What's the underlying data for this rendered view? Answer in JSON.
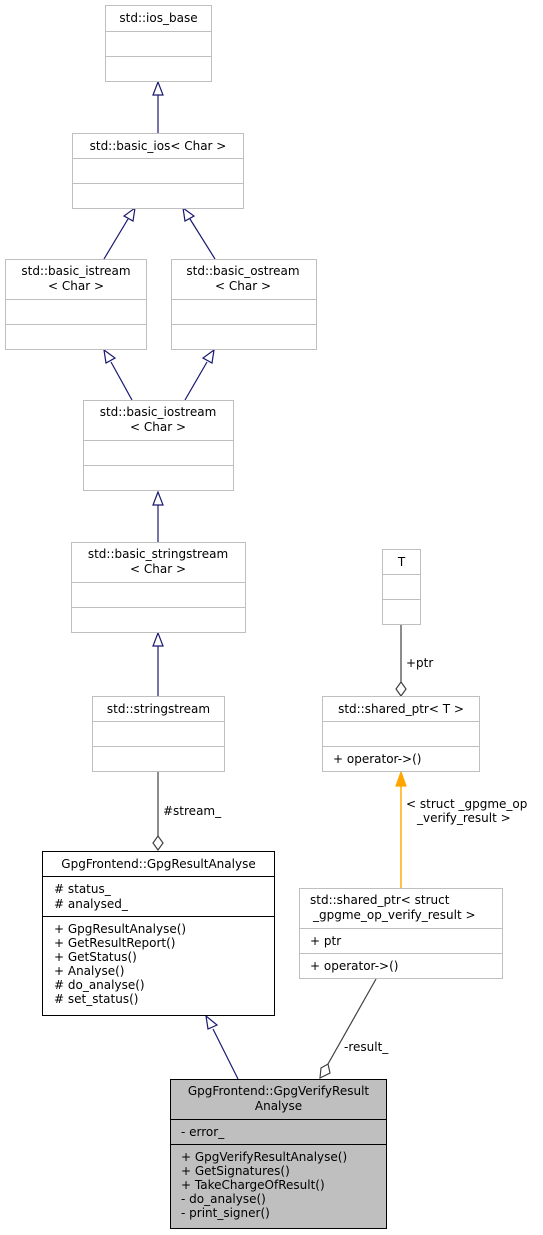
{
  "diagram": {
    "type": "uml-class-collaboration",
    "classes": {
      "ios_base": {
        "title": [
          "std::ios_base"
        ],
        "attributes": [],
        "methods": []
      },
      "basic_ios": {
        "title": [
          "std::basic_ios< Char >"
        ],
        "attributes": [],
        "methods": []
      },
      "basic_istream": {
        "title": [
          "std::basic_istream",
          "< Char >"
        ],
        "attributes": [],
        "methods": []
      },
      "basic_ostream": {
        "title": [
          "std::basic_ostream",
          "< Char >"
        ],
        "attributes": [],
        "methods": []
      },
      "basic_iostream": {
        "title": [
          "std::basic_iostream",
          "< Char >"
        ],
        "attributes": [],
        "methods": []
      },
      "basic_stringstream": {
        "title": [
          "std::basic_stringstream",
          "< Char >"
        ],
        "attributes": [],
        "methods": []
      },
      "stringstream": {
        "title": [
          "std::stringstream"
        ],
        "attributes": [],
        "methods": []
      },
      "T": {
        "title": [
          "T"
        ],
        "attributes": [],
        "methods": []
      },
      "shared_ptr_T": {
        "title": [
          "std::shared_ptr< T >"
        ],
        "attributes": [],
        "methods": [
          "+ operator->()"
        ]
      },
      "shared_ptr_verify": {
        "title": [
          "std::shared_ptr< struct",
          "_gpgme_op_verify_result >"
        ],
        "attributes": [
          "+ ptr"
        ],
        "methods": [
          "+ operator->()"
        ]
      },
      "GpgResultAnalyse": {
        "title": [
          "GpgFrontend::GpgResultAnalyse"
        ],
        "attributes": [
          "# status_",
          "# analysed_"
        ],
        "methods": [
          "+ GpgResultAnalyse()",
          "+ GetResultReport()",
          "+ GetStatus()",
          "+ Analyse()",
          "# do_analyse()",
          "# set_status()"
        ]
      },
      "GpgVerifyResultAnalyse": {
        "title": [
          "GpgFrontend::GpgVerifyResult",
          "Analyse"
        ],
        "attributes": [
          "- error_"
        ],
        "methods": [
          "+ GpgVerifyResultAnalyse()",
          "+ GetSignatures()",
          "+ TakeChargeOfResult()",
          "- do_analyse()",
          "- print_signer()"
        ]
      }
    },
    "edges": {
      "stream_label": "#stream_",
      "ptr_label": "+ptr",
      "template_label": [
        "< struct _gpgme_op",
        "_verify_result >"
      ],
      "result_label": "-result_"
    },
    "colors": {
      "inheritance": "#191970",
      "association": "#404040",
      "template": "#ffa500",
      "focus_fill": "#bfbfbf",
      "box_border": "#bfbfbf"
    }
  }
}
